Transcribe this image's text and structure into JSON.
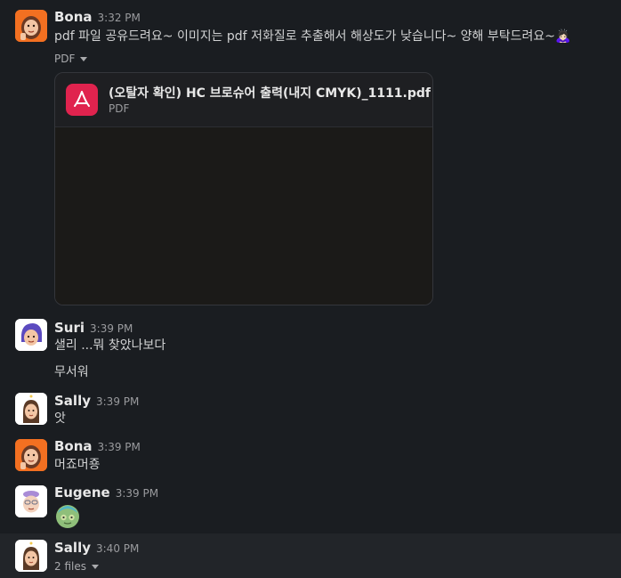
{
  "messages": [
    {
      "name": "Bona",
      "time": "3:32 PM",
      "text": "pdf 파일 공유드려요~ 이미지는 pdf 저화질로 추출해서 해상도가 낮습니다~ 양해 부탁드려요~🙇🏻‍♀️",
      "attachment_toggle": "PDF",
      "file": {
        "name": "(오탈자 확인) HC 브로슈어 출력(내지 CMYK)_1111.pdf",
        "type": "PDF"
      }
    },
    {
      "name": "Suri",
      "time": "3:39 PM",
      "lines": [
        "샐리 ...뭐 찾았나보다",
        "무서워"
      ]
    },
    {
      "name": "Sally",
      "time": "3:39 PM",
      "text": "앗"
    },
    {
      "name": "Bona",
      "time": "3:39 PM",
      "text": "머죠머죵"
    },
    {
      "name": "Eugene",
      "time": "3:39 PM",
      "emoji": "face-mask-icon"
    },
    {
      "name": "Sally",
      "time": "3:40 PM",
      "files_toggle": "2 files"
    }
  ],
  "colors": {
    "background": "#1a1d21",
    "pdf_icon": "#e0234e",
    "hover_row": "#222529"
  }
}
